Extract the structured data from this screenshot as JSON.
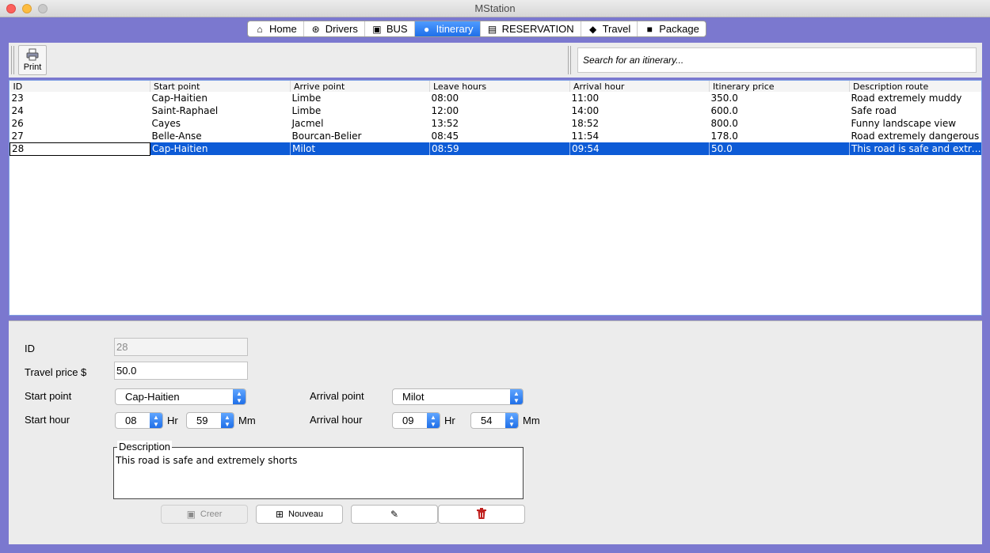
{
  "window": {
    "title": "MStation"
  },
  "tabs": [
    {
      "label": "Home",
      "icon": "home-icon"
    },
    {
      "label": "Drivers",
      "icon": "steering-wheel-icon"
    },
    {
      "label": "BUS",
      "icon": "bus-icon"
    },
    {
      "label": "Itinerary",
      "icon": "itinerary-icon",
      "active": true
    },
    {
      "label": "RESERVATION",
      "icon": "ticket-icon"
    },
    {
      "label": "Travel",
      "icon": "car-icon"
    },
    {
      "label": "Package",
      "icon": "package-icon"
    }
  ],
  "toolbar": {
    "print_label": "Print",
    "search_placeholder": "Search for an itinerary..."
  },
  "table": {
    "columns": [
      "ID",
      "Start point",
      "Arrive point",
      "Leave hours",
      "Arrival hour",
      "Itinerary price",
      "Description route"
    ],
    "rows": [
      [
        "23",
        "Cap-Haitien",
        "Limbe",
        "08:00",
        "11:00",
        "350.0",
        "Road extremely muddy"
      ],
      [
        "24",
        "Saint-Raphael",
        "Limbe",
        "12:00",
        "14:00",
        "600.0",
        "Safe road"
      ],
      [
        "26",
        "Cayes",
        "Jacmel",
        "13:52",
        "18:52",
        "800.0",
        "Funny landscape view"
      ],
      [
        "27",
        "Belle-Anse",
        "Bourcan-Belier",
        "08:45",
        "11:54",
        "178.0",
        "Road extremely dangerous"
      ],
      [
        "28",
        "Cap-Haitien",
        "Milot",
        "08:59",
        "09:54",
        "50.0",
        "This road is safe and extremely shorts"
      ]
    ],
    "selected_row": 4
  },
  "form": {
    "id_label": "ID",
    "id_value": "28",
    "price_label": "Travel price $",
    "price_value": "50.0",
    "start_point_label": "Start point",
    "start_point_value": "Cap-Haitien",
    "arrival_point_label": "Arrival point",
    "arrival_point_value": "Milot",
    "start_hour_label": "Start hour",
    "start_hr": "08",
    "start_mm": "59",
    "arrival_hour_label": "Arrival hour",
    "arrival_hr": "09",
    "arrival_mm": "54",
    "hr_unit": "Hr",
    "mm_unit": "Mm",
    "description_label": "Description",
    "description_value": "This road is safe and extremely shorts",
    "buttons": {
      "create": "Creer",
      "new": "Nouveau"
    }
  },
  "colors": {
    "background": "#7b78cf",
    "selection": "#0d5bd6",
    "accent": "#1e6fe9"
  }
}
